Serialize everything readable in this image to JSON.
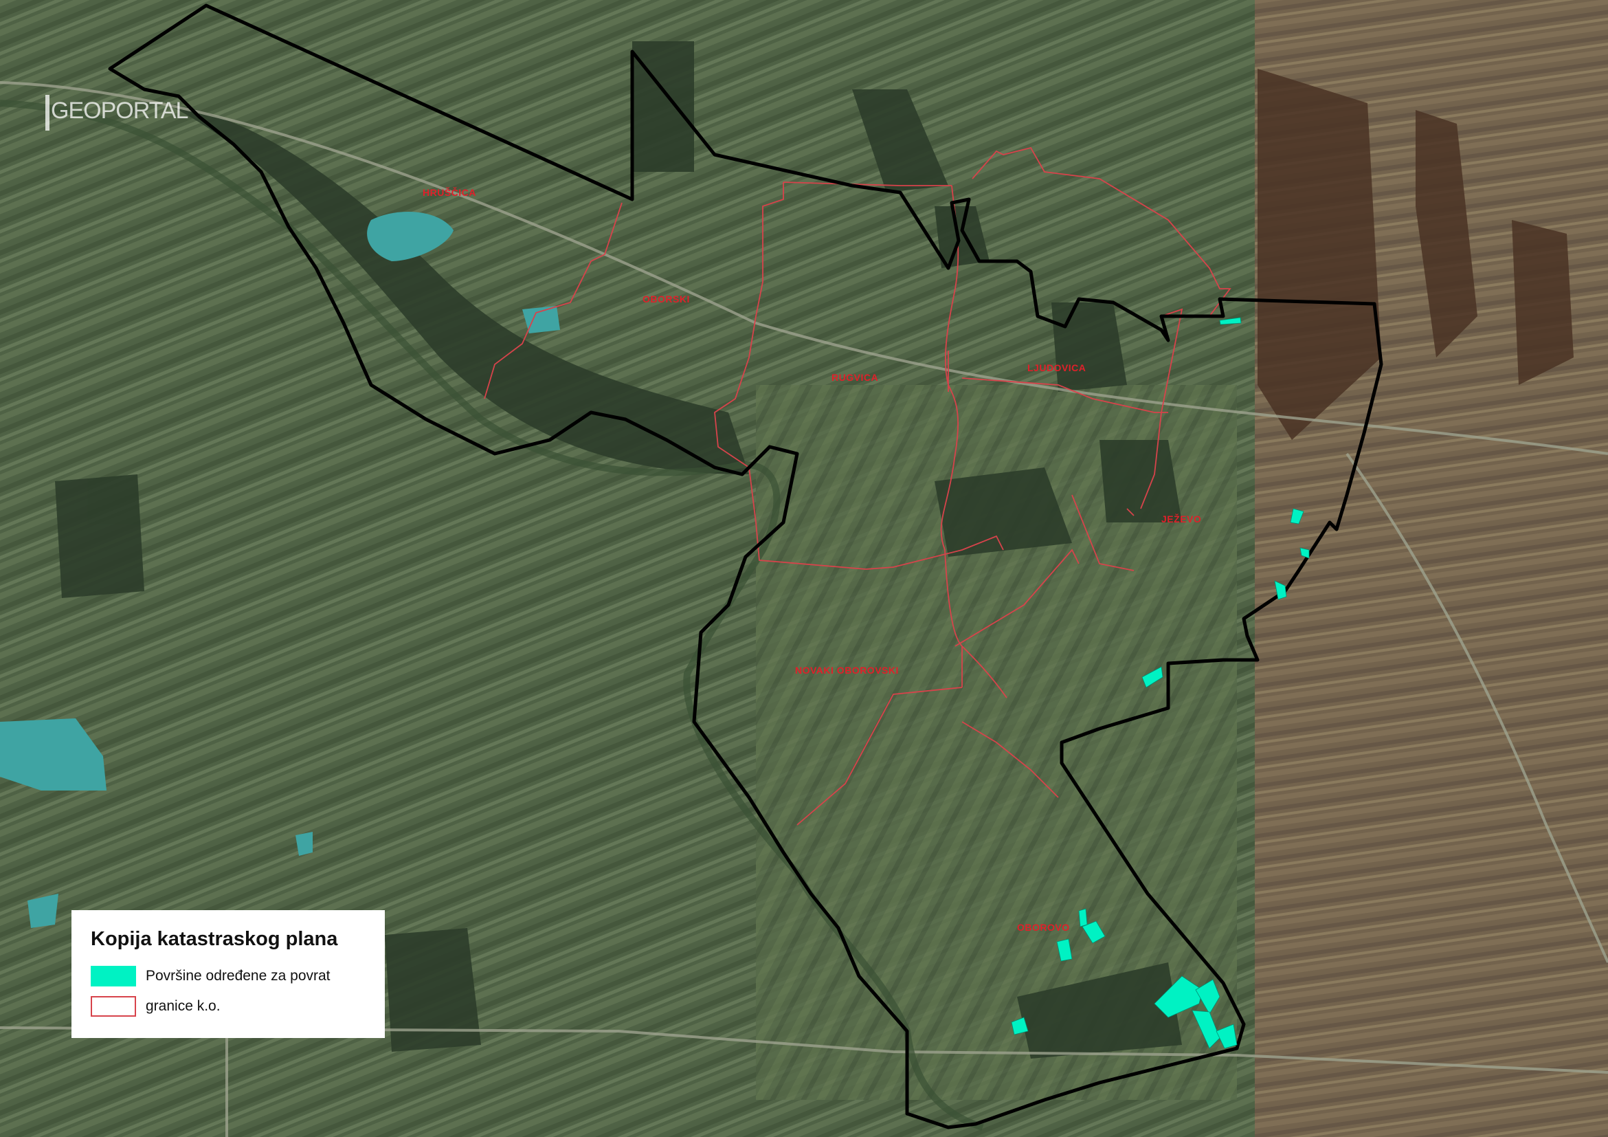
{
  "watermark": "GEOPORTAL",
  "legend": {
    "title": "Kopija katastraskog plana",
    "items": [
      {
        "label": "Površine određene za povrat",
        "color": "#00f2c3",
        "style": "fill"
      },
      {
        "label": "granice k.o.",
        "color": "#d7434b",
        "style": "outline"
      }
    ]
  },
  "places": [
    {
      "name": "HRUŠČICA"
    },
    {
      "name": "OBORSKI"
    },
    {
      "name": "RUGVICA"
    },
    {
      "name": "LJUDOVICA"
    },
    {
      "name": "JEŽEVO"
    },
    {
      "name": "NOVAKI OBOROVSKI"
    },
    {
      "name": "OBOROVO"
    }
  ],
  "colors": {
    "project_boundary": "#000000",
    "cadastral_boundary": "#d7434b",
    "return_areas": "#00f2c3",
    "imagery_base": "#4d5e42",
    "imagery_east": "#6b5a44"
  }
}
